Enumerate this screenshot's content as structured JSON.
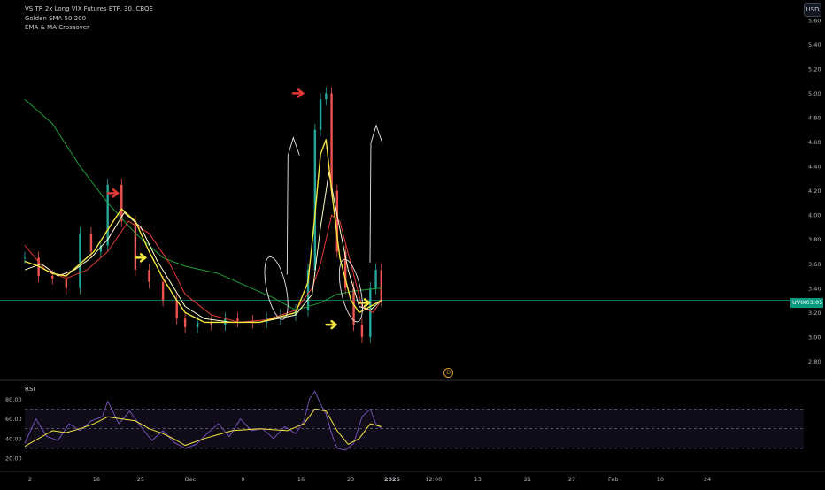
{
  "legend": {
    "symbol_line": "VS TR 2x Long VIX Futures ETF, 30, CBOE",
    "indicator_1": "Golden SMA 50 200",
    "indicator_2": "EMA & MA Crossover"
  },
  "currency_label": "USD",
  "last_price_tag": {
    "symbol": "UVIX",
    "time": "03:05"
  },
  "dividend_marker": "D",
  "colors": {
    "background": "#000000",
    "candle_up": "#26a69a",
    "candle_down": "#ef5350",
    "sma200": "#1f9a3a",
    "ema_fast": "#f5e642",
    "ema_mid": "#ffffcc",
    "ma_red": "#e53935",
    "rsi_line": "#7e57c2",
    "rsi_ma": "#f5e642",
    "rsi_band": "#7e57c2",
    "annotation_red": "#e53935",
    "annotation_yellow": "#f5e642",
    "annotation_white": "#e8e8e8"
  },
  "chart_data": [
    {
      "type": "line",
      "title": "",
      "subtitle": "",
      "y_tick_labels": [
        "5.60",
        "5.40",
        "5.20",
        "5.00",
        "4.80",
        "4.60",
        "4.40",
        "4.20",
        "4.00",
        "3.80",
        "3.60",
        "3.40",
        "3.20",
        "3.00",
        "2.80"
      ],
      "y_ticks": [
        5.6,
        5.4,
        5.2,
        5.0,
        4.8,
        4.6,
        4.4,
        4.2,
        4.0,
        3.8,
        3.6,
        3.4,
        3.2,
        3.0,
        2.8
      ],
      "ylim": [
        2.68,
        5.62
      ],
      "x_tick_labels": [
        "2",
        "18",
        "25",
        "Dec",
        "9",
        "16",
        "23",
        "2025",
        "12:00",
        "13",
        "21",
        "27",
        "Feb",
        "10",
        "24"
      ],
      "x_ticks": [
        0,
        48,
        80,
        116,
        154,
        196,
        232,
        262,
        292,
        324,
        360,
        392,
        422,
        456,
        490
      ],
      "xlim": [
        0,
        556
      ],
      "grid": false,
      "last_price": 3.3,
      "series": [
        {
          "name": "Price",
          "style": "candles",
          "x": [
            0,
            10,
            20,
            30,
            40,
            48,
            55,
            60,
            70,
            80,
            90,
            100,
            110,
            116,
            125,
            135,
            145,
            154,
            165,
            175,
            185,
            196,
            205,
            210,
            214,
            218,
            222,
            226,
            232,
            238,
            244,
            250,
            254,
            258
          ],
          "values": [
            3.65,
            3.5,
            3.48,
            3.4,
            3.85,
            3.7,
            3.75,
            4.25,
            3.95,
            3.55,
            3.45,
            3.3,
            3.15,
            3.08,
            3.12,
            3.1,
            3.15,
            3.13,
            3.12,
            3.15,
            3.18,
            3.22,
            3.55,
            4.7,
            4.95,
            5.0,
            4.2,
            3.7,
            3.4,
            3.1,
            3.0,
            3.4,
            3.55,
            3.3
          ]
        },
        {
          "name": "SMA200",
          "x": [
            0,
            20,
            40,
            60,
            80,
            100,
            116,
            140,
            160,
            180,
            196,
            214,
            226,
            240,
            258
          ],
          "values": [
            4.95,
            4.75,
            4.4,
            4.1,
            3.85,
            3.65,
            3.58,
            3.52,
            3.42,
            3.32,
            3.22,
            3.28,
            3.35,
            3.38,
            3.4
          ]
        },
        {
          "name": "EMA",
          "x": [
            0,
            10,
            20,
            30,
            40,
            50,
            60,
            70,
            80,
            90,
            100,
            110,
            116,
            130,
            150,
            170,
            196,
            205,
            210,
            214,
            218,
            222,
            228,
            236,
            242,
            250,
            258
          ],
          "values": [
            3.62,
            3.58,
            3.52,
            3.5,
            3.6,
            3.7,
            3.88,
            4.05,
            3.95,
            3.7,
            3.48,
            3.3,
            3.2,
            3.12,
            3.12,
            3.12,
            3.2,
            3.45,
            4.0,
            4.5,
            4.62,
            4.2,
            3.65,
            3.3,
            3.2,
            3.25,
            3.3
          ]
        },
        {
          "name": "EMA2",
          "x": [
            0,
            12,
            24,
            36,
            48,
            60,
            72,
            84,
            96,
            108,
            116,
            130,
            150,
            170,
            196,
            208,
            214,
            220,
            226,
            234,
            242,
            250,
            258
          ],
          "values": [
            3.55,
            3.6,
            3.5,
            3.55,
            3.65,
            3.8,
            4.02,
            3.9,
            3.62,
            3.4,
            3.25,
            3.15,
            3.12,
            3.12,
            3.18,
            3.35,
            3.9,
            4.35,
            4.0,
            3.55,
            3.25,
            3.22,
            3.3
          ]
        },
        {
          "name": "MA",
          "x": [
            0,
            15,
            30,
            45,
            60,
            75,
            90,
            105,
            116,
            135,
            155,
            175,
            196,
            208,
            214,
            222,
            228,
            236,
            244,
            252,
            258
          ],
          "values": [
            3.75,
            3.55,
            3.48,
            3.55,
            3.7,
            3.95,
            3.85,
            3.6,
            3.35,
            3.18,
            3.12,
            3.14,
            3.22,
            3.4,
            3.6,
            4.0,
            3.95,
            3.6,
            3.25,
            3.2,
            3.3
          ]
        }
      ],
      "annotations": [
        {
          "type": "arrow",
          "color": "red",
          "x": 64,
          "y": 4.18
        },
        {
          "type": "arrow",
          "color": "red",
          "x": 198,
          "y": 5.0
        },
        {
          "type": "arrow",
          "color": "yellow",
          "x": 84,
          "y": 3.65
        },
        {
          "type": "arrow",
          "color": "yellow",
          "x": 222,
          "y": 3.1
        },
        {
          "type": "arrow",
          "color": "yellow",
          "x": 246,
          "y": 3.28
        },
        {
          "type": "ellipse",
          "x": 182,
          "y": 3.4
        },
        {
          "type": "ellipse",
          "x": 236,
          "y": 3.38
        },
        {
          "type": "freehand-up-arrow",
          "x": 193,
          "y": 4.2
        },
        {
          "type": "freehand-up-arrow",
          "x": 253,
          "y": 4.3
        }
      ]
    },
    {
      "type": "line",
      "title": "RSI",
      "y_tick_labels": [
        "80.00",
        "60.00",
        "40.00",
        "20.00"
      ],
      "y_ticks": [
        80,
        60,
        40,
        20
      ],
      "ylim": [
        11,
        92
      ],
      "bands": {
        "upper": 70,
        "middle": 50,
        "lower": 30
      },
      "xlim": [
        0,
        556
      ],
      "series": [
        {
          "name": "RSI",
          "x": [
            0,
            8,
            16,
            24,
            32,
            40,
            48,
            56,
            60,
            68,
            76,
            84,
            92,
            100,
            108,
            116,
            124,
            132,
            140,
            148,
            156,
            164,
            172,
            180,
            188,
            196,
            202,
            206,
            210,
            214,
            218,
            222,
            226,
            232,
            238,
            244,
            250,
            254,
            258
          ],
          "values": [
            35,
            60,
            42,
            38,
            55,
            48,
            58,
            62,
            78,
            55,
            68,
            52,
            38,
            48,
            36,
            30,
            34,
            45,
            55,
            42,
            60,
            48,
            50,
            40,
            52,
            45,
            58,
            80,
            88,
            75,
            65,
            45,
            30,
            28,
            35,
            62,
            70,
            55,
            50
          ]
        },
        {
          "name": "RSI MA",
          "x": [
            0,
            10,
            20,
            30,
            40,
            50,
            60,
            70,
            80,
            90,
            100,
            110,
            116,
            130,
            150,
            170,
            190,
            202,
            210,
            218,
            226,
            234,
            242,
            250,
            258
          ],
          "values": [
            32,
            40,
            48,
            46,
            50,
            55,
            62,
            60,
            58,
            50,
            45,
            38,
            33,
            40,
            48,
            50,
            48,
            55,
            70,
            68,
            48,
            34,
            40,
            55,
            52
          ]
        }
      ]
    }
  ]
}
